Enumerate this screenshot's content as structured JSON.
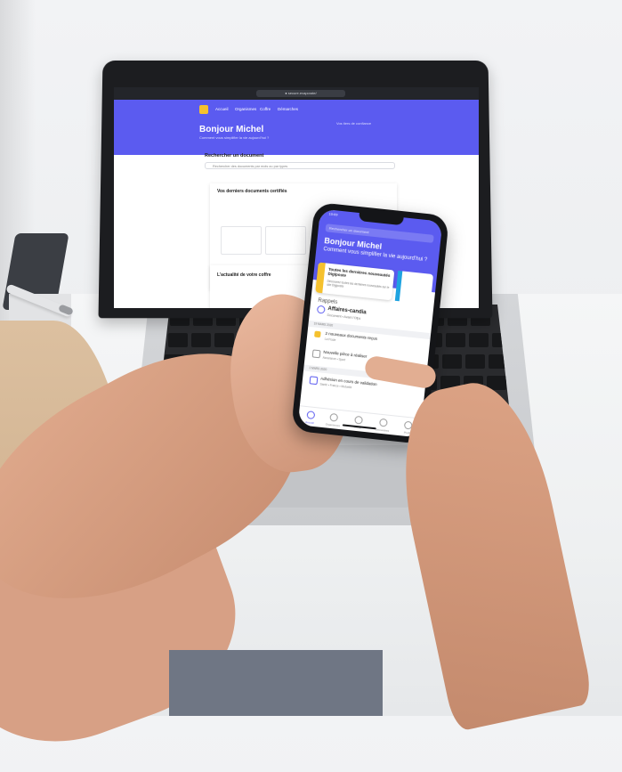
{
  "laptop": {
    "url": "● secure.evaporate/",
    "nav": [
      "Accueil",
      "Organismes",
      "Coffre",
      "Démarches"
    ],
    "greeting": "Bonjour Michel",
    "greeting_sub": "Comment vous simplifier la vie aujourd’hui ?",
    "right_note": "Vos tiers de confiance",
    "search_title": "Rechercher un document",
    "search_placeholder": "Rechercher des documents par mots ou par types",
    "card_title": "Vos derniers documents certifiés",
    "card2_title": "L’actualité de votre coffre"
  },
  "phone": {
    "time": "10:09",
    "search_placeholder": "Rechercher un document",
    "greeting": "Bonjour Michel",
    "greeting_sub": "Comment vous simplifier la vie aujourd’hui ?",
    "promo_title": "Toutes les dernières nouveautés Digiposte",
    "promo_sub": "Découvrez toutes les dernières nouveautés sur le site Digiposte",
    "rappels": "Rappels",
    "doc_title": "Affaires-candia",
    "doc_sub": "Document • Avant l’Ofps",
    "date1": "19 MARS 2020",
    "item1": "2 nouveaux documents reçus",
    "item1_sub": "La Poste",
    "item2": "Nouvelle pièce à réaliser",
    "item2_sub": "Assurance • Sport",
    "date2": "1 MARS 2020",
    "item3": "Adhésion en cours de validation",
    "item3_sub": "Santé • France • Mutuelle",
    "tabs": [
      "Accueil",
      "Organismes",
      "Coffre",
      "Démarches",
      "Profil"
    ]
  },
  "colors": {
    "brand": "#5b5bf0",
    "accent": "#f5c12e"
  }
}
